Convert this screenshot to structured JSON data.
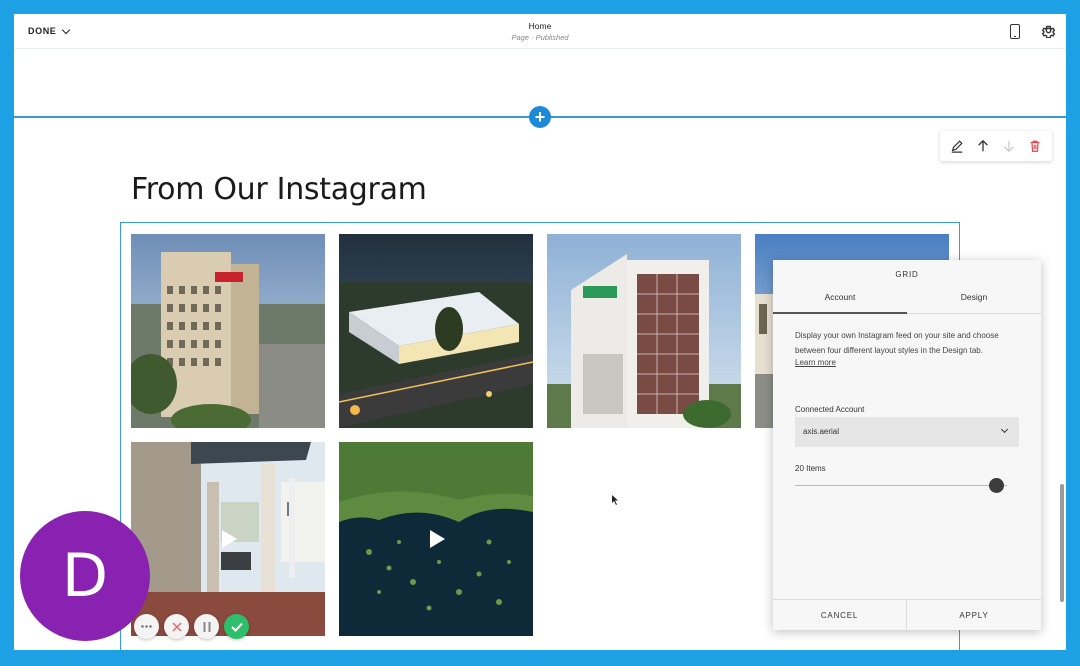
{
  "topbar": {
    "done_label": "DONE",
    "page_title": "Home",
    "page_status": "Page · Published"
  },
  "section": {
    "heading": "From Our Instagram"
  },
  "block_toolbar": {
    "icons": [
      "pencil-icon",
      "arrow-up-icon",
      "arrow-down-icon",
      "trash-icon"
    ]
  },
  "grid": {
    "tiles": [
      {
        "subject": "building",
        "video": false
      },
      {
        "subject": "tent-venue-night",
        "video": false
      },
      {
        "subject": "glass-tower",
        "video": false
      },
      {
        "subject": "sky-building",
        "video": false
      },
      {
        "subject": "pergola-columns",
        "video": true
      },
      {
        "subject": "lake-aerial",
        "video": true
      }
    ]
  },
  "panel": {
    "title": "GRID",
    "tabs": [
      "Account",
      "Design"
    ],
    "active_tab": "Account",
    "description": "Display your own Instagram feed on your site and choose between four different layout styles in the Design tab.",
    "learn_more": "Learn more",
    "connected_account_label": "Connected Account",
    "connected_account_value": "axis.aerial",
    "items_label": "20 Items",
    "items_slider_fraction": 0.95,
    "cancel_label": "CANCEL",
    "apply_label": "APPLY"
  },
  "avatar": {
    "initial": "D",
    "color": "#8a22b1"
  },
  "colors": {
    "border": "#1ea0e4",
    "accent": "#1c8ad6",
    "selection": "#3a9ad9",
    "confirm": "#2fbf6a"
  }
}
